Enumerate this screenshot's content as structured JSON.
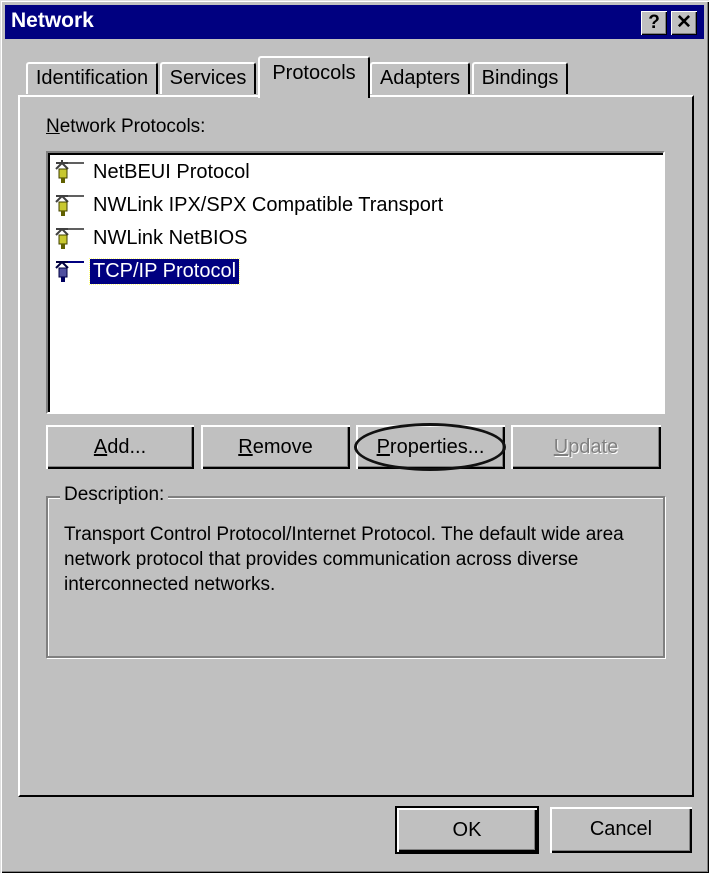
{
  "window": {
    "title": "Network",
    "help_label": "?",
    "close_label": "✕"
  },
  "tabs": [
    {
      "label": "Identification",
      "active": false
    },
    {
      "label": "Services",
      "active": false
    },
    {
      "label": "Protocols",
      "active": true
    },
    {
      "label": "Adapters",
      "active": false
    },
    {
      "label": "Bindings",
      "active": false
    }
  ],
  "protocols": {
    "label_prefix": "N",
    "label_rest": "etwork Protocols:",
    "items": [
      {
        "label": "NetBEUI Protocol",
        "icon": "network-protocol-icon",
        "selected": false
      },
      {
        "label": "NWLink IPX/SPX Compatible Transport",
        "icon": "network-protocol-icon",
        "selected": false
      },
      {
        "label": "NWLink NetBIOS",
        "icon": "network-protocol-icon",
        "selected": false
      },
      {
        "label": "TCP/IP Protocol",
        "icon": "network-protocol-icon",
        "selected": true
      }
    ]
  },
  "buttons": {
    "add": {
      "mnemonic": "A",
      "rest": "dd..."
    },
    "remove": {
      "mnemonic": "R",
      "rest": "emove"
    },
    "properties": {
      "mnemonic": "P",
      "rest": "roperties..."
    },
    "update": {
      "mnemonic": "U",
      "rest": "pdate",
      "disabled": true
    }
  },
  "description": {
    "label": "Description:",
    "text": "Transport Control Protocol/Internet Protocol. The default wide area network protocol that provides communication across diverse interconnected networks."
  },
  "footer": {
    "ok": "OK",
    "cancel": "Cancel"
  },
  "colors": {
    "titlebar": "#000080",
    "face": "#c0c0c0",
    "selection": "#000080"
  }
}
